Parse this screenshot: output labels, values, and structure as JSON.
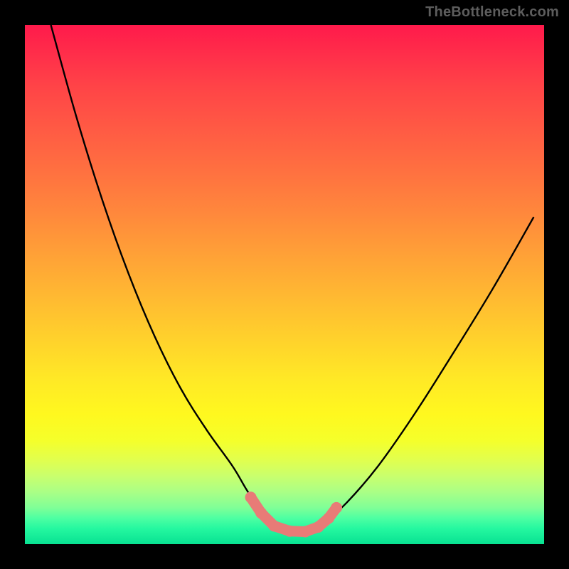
{
  "watermark": "TheBottleneck.com",
  "chart_data": {
    "type": "line",
    "title": "",
    "xlabel": "",
    "ylabel": "",
    "xlim": [
      0,
      100
    ],
    "ylim": [
      0,
      100
    ],
    "grid": false,
    "legend": false,
    "annotations": [],
    "series": [
      {
        "name": "curve",
        "color": "#000000",
        "x": [
          5,
          10,
          15,
          20,
          25,
          30,
          35,
          40,
          43,
          46,
          48,
          50,
          52,
          54,
          56,
          58,
          62,
          68,
          75,
          82,
          90,
          98
        ],
        "y": [
          100,
          82,
          66,
          52,
          40,
          30,
          22,
          15,
          10,
          6,
          3.5,
          2.5,
          2.2,
          2.3,
          3,
          4.5,
          8,
          15,
          25,
          36,
          49,
          63
        ]
      },
      {
        "name": "markers",
        "type": "scatter",
        "color": "#e87b77",
        "x": [
          43.5,
          45.5,
          48,
          51,
          54,
          56.5,
          58.5,
          60
        ],
        "y": [
          9,
          6,
          3.5,
          2.5,
          2.4,
          3.3,
          5,
          7
        ]
      }
    ]
  }
}
